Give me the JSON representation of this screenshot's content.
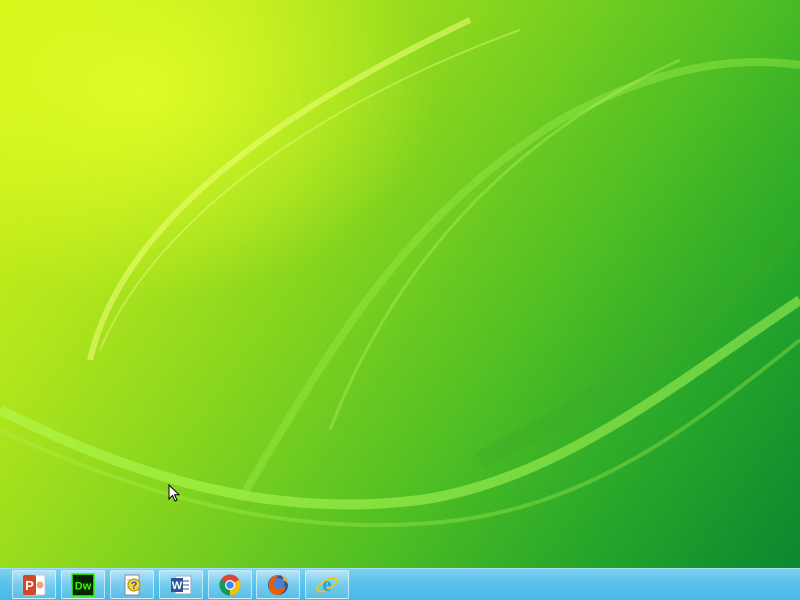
{
  "desktop": {
    "wallpaper": "green-swoosh-wallpaper",
    "colors": {
      "light": "#d6f516",
      "mid": "#7fd21f",
      "dark": "#0b8730"
    }
  },
  "taskbar": {
    "color": "#5cc3ec",
    "pinned": [
      {
        "id": "powerpoint",
        "icon": "powerpoint-icon",
        "glyph": "P",
        "color": "#d24726"
      },
      {
        "id": "dreamweaver",
        "icon": "dreamweaver-icon",
        "glyph": "Dw",
        "color": "#35fa00"
      },
      {
        "id": "help",
        "icon": "help-document-icon",
        "glyph": "?",
        "color": "#1f5fbf"
      },
      {
        "id": "word",
        "icon": "word-icon",
        "glyph": "W",
        "color": "#2b5797"
      },
      {
        "id": "chrome",
        "icon": "chrome-icon",
        "color": "#db4437"
      },
      {
        "id": "firefox",
        "icon": "firefox-icon",
        "color": "#e66000"
      },
      {
        "id": "internet-explorer",
        "icon": "internet-explorer-icon",
        "glyph": "e",
        "color": "#1ba1e2"
      }
    ]
  }
}
